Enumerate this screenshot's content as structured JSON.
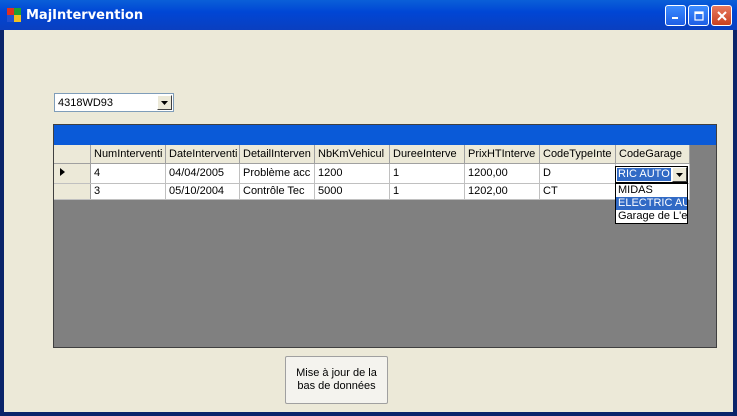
{
  "window": {
    "title": "MajIntervention"
  },
  "vehicle_select": {
    "value": "4318WD93"
  },
  "grid": {
    "columns": [
      "NumInterventi",
      "DateInterventi",
      "DetailInterven",
      "NbKmVehicul",
      "DureeInterve",
      "PrixHTInterve",
      "CodeTypeInte",
      "CodeGarage"
    ],
    "rows": [
      {
        "current": true,
        "cells": [
          "4",
          "04/04/2005",
          "Problème acc",
          "1200",
          "1",
          "1200,00",
          "D",
          ""
        ]
      },
      {
        "current": false,
        "cells": [
          "3",
          "05/10/2004",
          "Contrôle Tec",
          "5000",
          "1",
          "1202,00",
          "CT",
          ""
        ]
      }
    ],
    "editing_cell": {
      "value": "RIC AUTO"
    },
    "dropdown_options": [
      {
        "label": "MIDAS",
        "selected": false
      },
      {
        "label": "ELECTRIC AU",
        "selected": true
      },
      {
        "label": "Garage de L'es",
        "selected": false
      }
    ],
    "row_indicator_icon": "right-triangle-icon",
    "caption_color": "#0a5ad8"
  },
  "update_button": {
    "label_line1": "Mise à jour de la",
    "label_line2": "bas de données"
  }
}
